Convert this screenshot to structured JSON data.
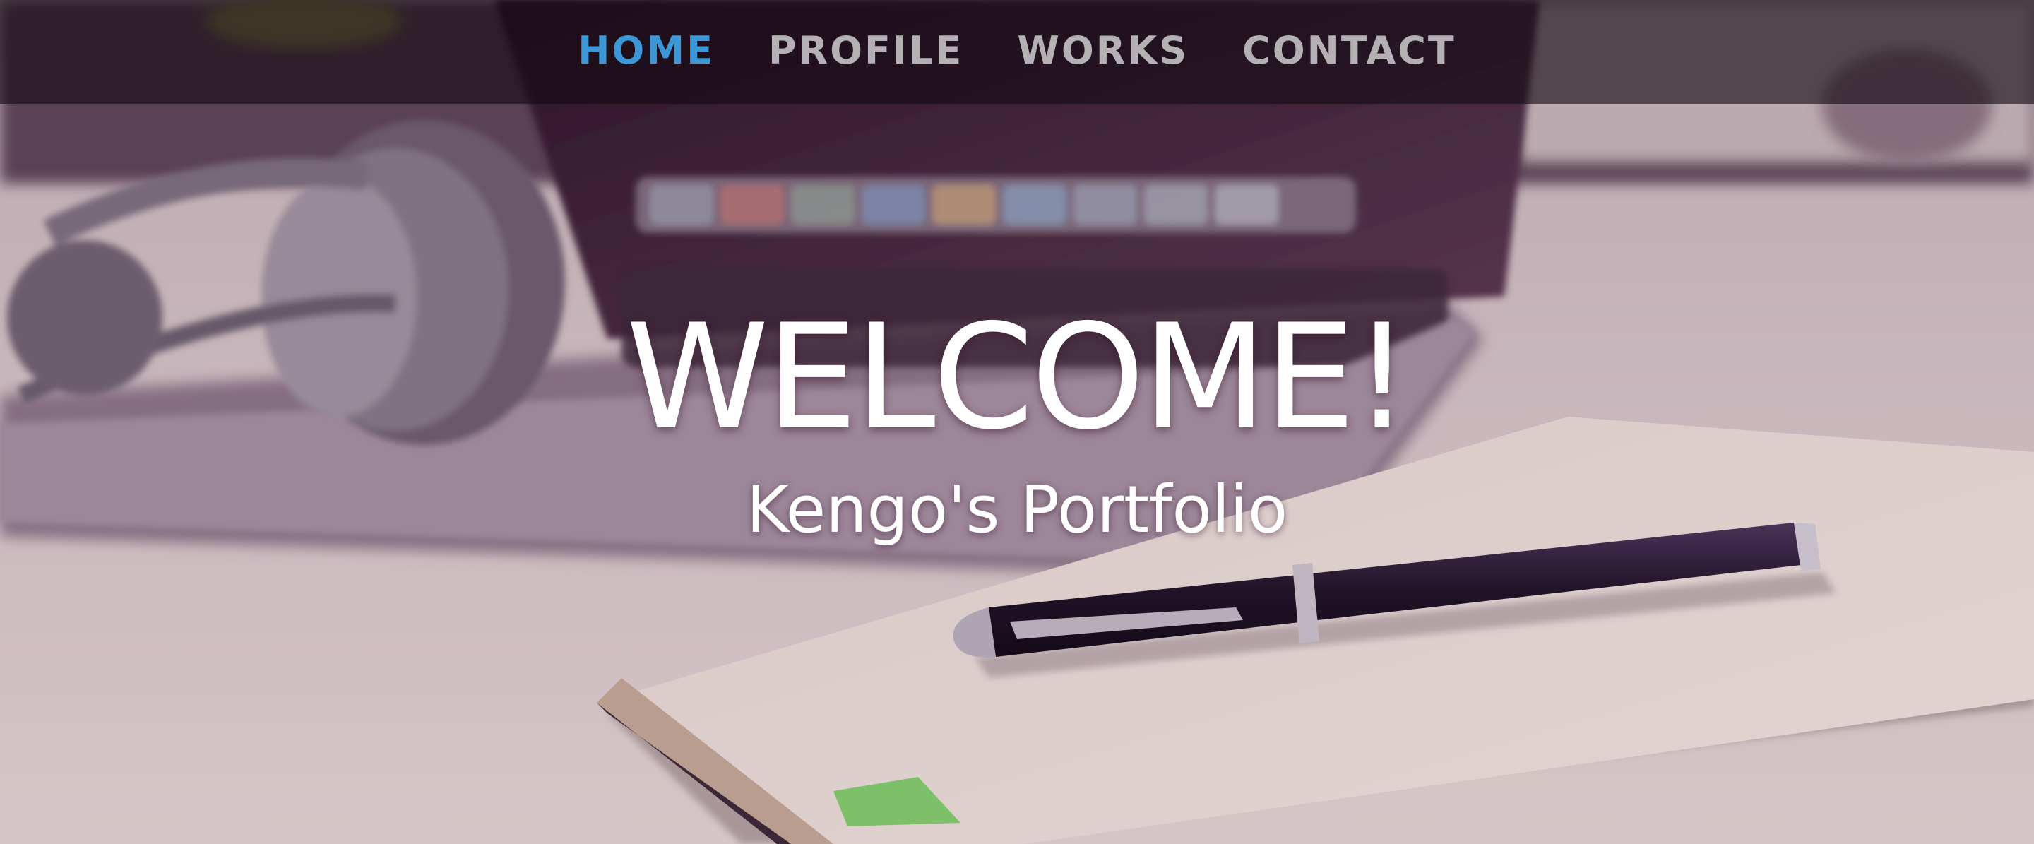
{
  "nav": {
    "items": [
      {
        "label": "HOME",
        "active": true
      },
      {
        "label": "PROFILE",
        "active": false
      },
      {
        "label": "WORKS",
        "active": false
      },
      {
        "label": "CONTACT",
        "active": false
      }
    ],
    "active_color": "#3d97d6",
    "inactive_color": "#b4b0b4"
  },
  "hero": {
    "title": "WELCOME!",
    "subtitle": "Kengo's Portfolio",
    "background_image": "laptop-headphones-notebook-pen-photo"
  }
}
